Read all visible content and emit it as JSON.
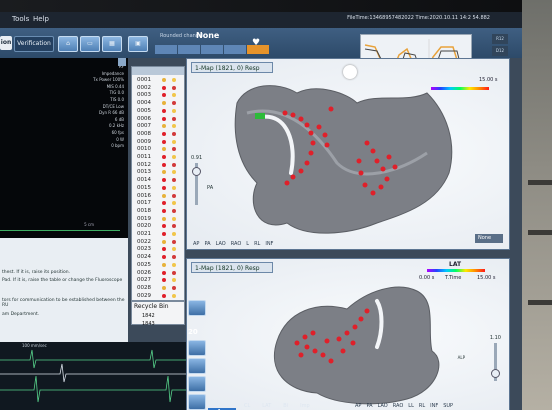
{
  "menu": {
    "tools": "Tools",
    "help": "Help",
    "file_time": "FileTime:13468957482022 Time:2020.10.11 14:2 54.882"
  },
  "toolbar": {
    "tab_active": "ion",
    "tab_verification": "Verification",
    "rounded_channel_label": "Rounded channel:",
    "rounded_channel_value": "None",
    "segments": [
      "",
      "",
      "",
      "",
      ""
    ]
  },
  "left": {
    "readouts": [
      "RF",
      "Impedance",
      "Tx Power 100%",
      "MIS 0.44",
      "TIG 0.0",
      "TIS 0.0",
      "DT/CE Low",
      "Dyn R 66 dB",
      "6 dB",
      "0.2 kHz",
      "60 fps",
      "0 W",
      "0 bpm"
    ],
    "lines": [
      "thest. If it is, raise its position.",
      "Pad. If it is, raise the table or change the Fluoroscope",
      "",
      "tors for communication to be established between the RU",
      "",
      "am Department."
    ],
    "ecg_title": "100 mm/sec",
    "cm_label": "5 cm"
  },
  "points": [
    "0001",
    "0002",
    "0003",
    "0004",
    "0005",
    "0006",
    "0007",
    "0008",
    "0009",
    "0010",
    "0011",
    "0012",
    "0013",
    "0014",
    "0015",
    "0016",
    "0017",
    "0018",
    "0019",
    "0020",
    "0021",
    "0022",
    "0023",
    "0024",
    "0025",
    "0026",
    "0027",
    "0028",
    "0029"
  ],
  "recycle": {
    "title": "Recycle Bin",
    "items": [
      "1842",
      "1843"
    ]
  },
  "map_top": {
    "dropdown": "1-Map (1821, 0) Resp",
    "time_value": "15.00 s",
    "slider_value": "0.91",
    "pa_label": "PA",
    "views": [
      "AP",
      "PA",
      "LAO",
      "RAO",
      "L",
      "RL",
      "INF"
    ],
    "none_dropdown": "None"
  },
  "map_bot": {
    "dropdown": "1-Map (1821, 0) Resp",
    "lat_label": "LAT",
    "time_start": "0.00 s",
    "ttime_label": "T.Time",
    "time_end": "15.00 s",
    "slider_value": "1.10",
    "alp_label": "ALP"
  },
  "bottom": {
    "zoom": "20",
    "tabs": [
      "CL",
      "LAT",
      "Bi",
      "Imp"
    ],
    "views": [
      "AP",
      "PA",
      "LAO",
      "RAO",
      "LL",
      "RL",
      "INF",
      "SUP"
    ],
    "uire": "uire"
  },
  "colors": {
    "toolbar": "#2d4a69",
    "orange_segment": "#e6932a",
    "map_dots": "#e0202a"
  }
}
